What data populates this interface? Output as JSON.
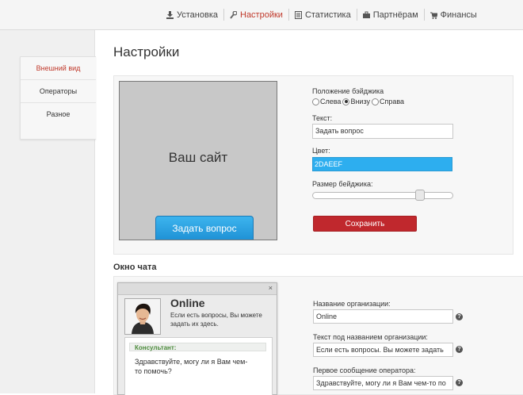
{
  "nav": {
    "items": [
      {
        "label": "Установка",
        "icon": "download-icon",
        "active": false
      },
      {
        "label": "Настройки",
        "icon": "wrench-icon",
        "active": true
      },
      {
        "label": "Статистика",
        "icon": "document-icon",
        "active": false
      },
      {
        "label": "Партнёрам",
        "icon": "briefcase-icon",
        "active": false
      },
      {
        "label": "Финансы",
        "icon": "cart-icon",
        "active": false
      }
    ],
    "active_color": "#c0392b"
  },
  "sidebar": {
    "items": [
      {
        "label": "Внешний вид",
        "active": true
      },
      {
        "label": "Операторы",
        "active": false
      },
      {
        "label": "Разное",
        "active": false
      }
    ]
  },
  "page_title": "Настройки",
  "badge": {
    "preview_text": "Ваш сайт",
    "preview_button": "Задать вопрос",
    "position_label": "Положение бэйджика",
    "positions": [
      "Слева",
      "Внизу",
      "Справа"
    ],
    "position_selected": "Внизу",
    "text_label": "Текст:",
    "text_value": "Задать вопрос",
    "color_label": "Цвет:",
    "color_value": "2DAEEF",
    "color_hex": "#2daeef",
    "size_label": "Размер бейджика:",
    "size_fraction": 0.78,
    "save_label": "Сохранить"
  },
  "chat_section": {
    "title": "Окно чата",
    "window": {
      "close_glyph": "×",
      "status": "Online",
      "status_sub": "Если есть вопросы, Вы можете задать их здесь.",
      "consultant_label": "Консультант:",
      "message": "Здравствуйте, могу ли я Вам чем-то помочь?"
    },
    "org_name_label": "Название организации:",
    "org_name_value": "Online",
    "org_sub_label": "Текст под названием организации:",
    "org_sub_value": "Если есть вопросы. Вы можете задать",
    "first_msg_label": "Первое сообщение оператора:",
    "first_msg_value": "Здравствуйте, могу ли я Вам чем-то по",
    "help_glyph": "?"
  }
}
